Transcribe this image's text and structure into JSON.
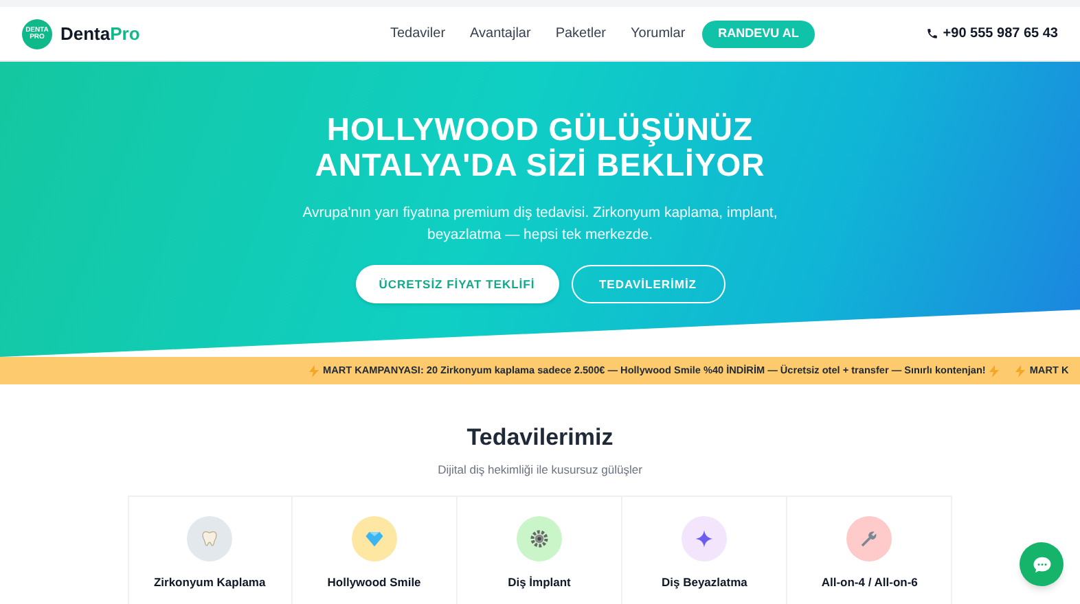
{
  "brand": {
    "logo_lines": [
      "DENTA",
      "PRO"
    ],
    "name": "Denta",
    "accent": "Pro"
  },
  "nav": {
    "links": [
      "Tedaviler",
      "Avantajlar",
      "Paketler",
      "Yorumlar"
    ],
    "cta": "RANDEVU AL",
    "phone": "+90 555 987 65 43"
  },
  "hero": {
    "title_lines": [
      "HOLLYWOOD GÜLÜŞÜNÜZ",
      "ANTALYA'DA SİZİ BEKLİYOR"
    ],
    "text": "Avrupa'nın yarı fiyatına premium diş tedavisi. Zirkonyum kaplama, implant, beyazlatma — hepsi tek merkezde.",
    "buttons": [
      {
        "label": "ÜCRETSİZ FİYAT TEKLİFİ",
        "kind": "solid"
      },
      {
        "label": "TEDAVİLERİMİZ",
        "kind": "outline"
      }
    ]
  },
  "ticker": [
    "MART KAMPANYASI: 20 Zirkonyum kaplama sadece 2.500€ — Hollywood Smile %40 İNDİRİM — Ücretsiz otel + transfer — Sınırlı kontenjan!",
    "MART K"
  ],
  "treatments": {
    "title": "Tedavilerimiz",
    "subtitle": "Dijital diş hekimliği ile kusursuz gülüşler",
    "cards": [
      {
        "title": "Zirkonyum Kaplama",
        "kind": "tooth",
        "color": "#e2e8ec"
      },
      {
        "title": "Hollywood Smile",
        "kind": "diamond",
        "color": "#fde7a3"
      },
      {
        "title": "Diş İmplant",
        "kind": "gear",
        "color": "#c9f5c9"
      },
      {
        "title": "Diş Beyazlatma",
        "kind": "sparkle",
        "color": "#f3e5fb"
      },
      {
        "title": "All-on-4 / All-on-6",
        "kind": "wrench",
        "color": "#fecaca"
      }
    ]
  }
}
